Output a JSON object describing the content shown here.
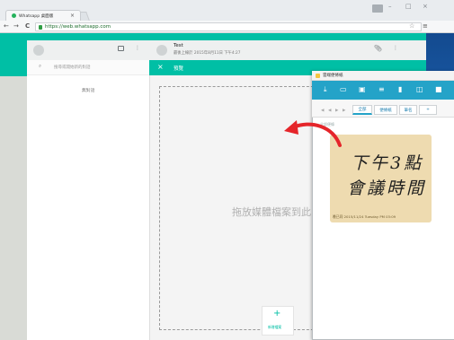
{
  "browser": {
    "tab_title": "Whatsapp 桌面版",
    "tab_close": "×",
    "url": "https://web.whatsapp.com",
    "back": "←",
    "forward": "→",
    "reload": "C",
    "star": "☆",
    "menu": "≡",
    "minimize": "–",
    "maximize": "□",
    "close": "×"
  },
  "whatsapp": {
    "search_placeholder": "搜尋或開始新的對話",
    "empty_state": "無對話",
    "dots": "⋮",
    "contact_name": "Test",
    "last_seen": "最後上線於 2015年8月11日 下午4:27",
    "preview_close": "×",
    "preview_title": "預覽",
    "drop_text": "拖放媒體檔案到此",
    "add_plus": "+",
    "add_label": "新增檔案"
  },
  "notes_app": {
    "title": "雲端便條紙",
    "tabs": [
      {
        "label": "全部"
      },
      {
        "label": "便條紙"
      },
      {
        "label": "筆名"
      },
      {
        "label": "+"
      }
    ],
    "list_header": "全部便條",
    "note": {
      "line1": "下午3點",
      "line2": "會議時間",
      "meta": "晚已同 2015/11/24 Tuesday PM 03:09"
    }
  },
  "colors": {
    "wa_teal": "#00bfa5",
    "notes_blue": "#24a3c8",
    "note_paper": "#eedbb0",
    "arrow_red": "#e5252a"
  }
}
